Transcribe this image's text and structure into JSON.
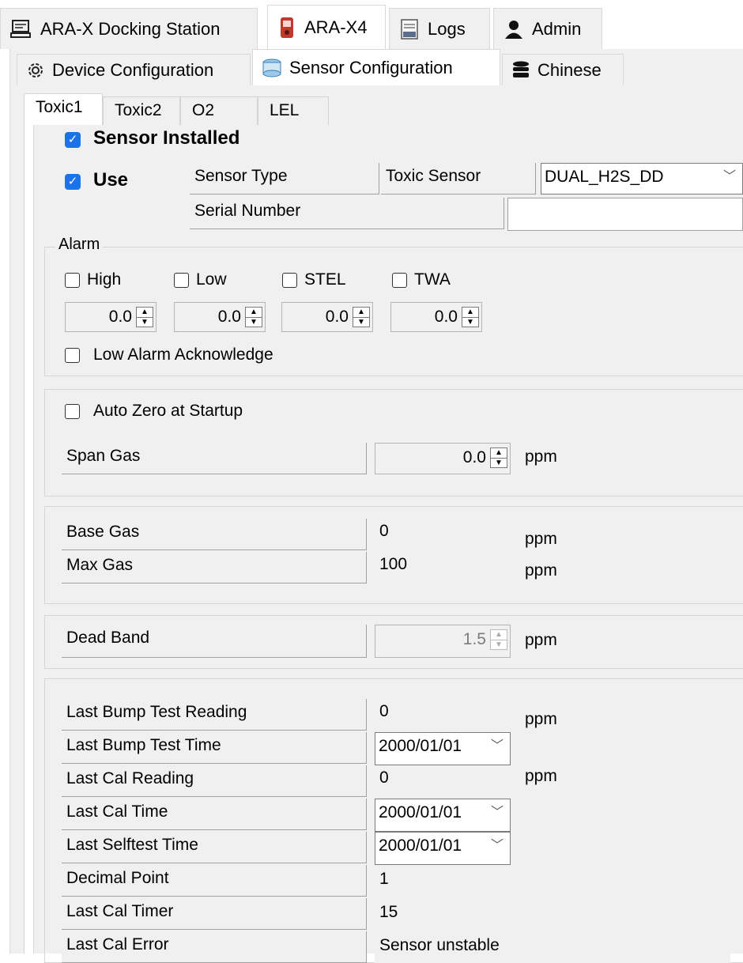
{
  "top_tabs": [
    {
      "label": "ARA-X Docking Station",
      "icon": "docking-station-icon"
    },
    {
      "label": "ARA-X4",
      "icon": "gas-detector-icon"
    },
    {
      "label": "Logs",
      "icon": "logs-icon"
    },
    {
      "label": "Admin",
      "icon": "user-icon"
    }
  ],
  "sub_tabs": [
    {
      "label": "Device Configuration",
      "icon": "gear-icon"
    },
    {
      "label": "Sensor Configuration",
      "icon": "sensor-icon"
    },
    {
      "label": "Chinese",
      "icon": "database-icon"
    }
  ],
  "sensor_tabs": [
    "Toxic1",
    "Toxic2",
    "O2",
    "LEL"
  ],
  "sensor": {
    "installed_label": "Sensor Installed",
    "installed_checked": true,
    "use_label": "Use",
    "use_checked": true,
    "sensor_type_label": "Sensor Type",
    "toxic_sensor_label": "Toxic Sensor",
    "sensor_type_value": "DUAL_H2S_DD",
    "serial_number_label": "Serial Number",
    "serial_number_value": ""
  },
  "alarm": {
    "title": "Alarm",
    "items": [
      {
        "label": "High",
        "value": "0.0"
      },
      {
        "label": "Low",
        "value": "0.0"
      },
      {
        "label": "STEL",
        "value": "0.0"
      },
      {
        "label": "TWA",
        "value": "0.0"
      }
    ],
    "low_ack_label": "Low Alarm Acknowledge"
  },
  "zero": {
    "auto_zero_label": "Auto Zero at Startup",
    "span_gas_label": "Span Gas",
    "span_gas_value": "0.0",
    "unit": "ppm"
  },
  "range": {
    "base_gas_label": "Base Gas",
    "base_gas_value": "0",
    "max_gas_label": "Max Gas",
    "max_gas_value": "100",
    "unit": "ppm"
  },
  "deadband": {
    "label": "Dead Band",
    "value": "1.5",
    "unit": "ppm"
  },
  "history": {
    "rows": [
      {
        "label": "Last Bump Test Reading",
        "value": "0",
        "unit": "ppm"
      },
      {
        "label": "Last Bump Test Time",
        "value": "2000/01/01"
      },
      {
        "label": "Last Cal Reading",
        "value": "0",
        "unit": "ppm"
      },
      {
        "label": "Last Cal Time",
        "value": "2000/01/01"
      },
      {
        "label": "Last Selftest Time",
        "value": "2000/01/01"
      },
      {
        "label": "Decimal Point",
        "value": "1"
      },
      {
        "label": "Last Cal Timer",
        "value": "15"
      },
      {
        "label": "Last Cal Error",
        "value": "Sensor unstable"
      }
    ]
  },
  "colors": {
    "checkbox_checked": "#1a73e8",
    "panel_bg": "#f0f0f0"
  }
}
